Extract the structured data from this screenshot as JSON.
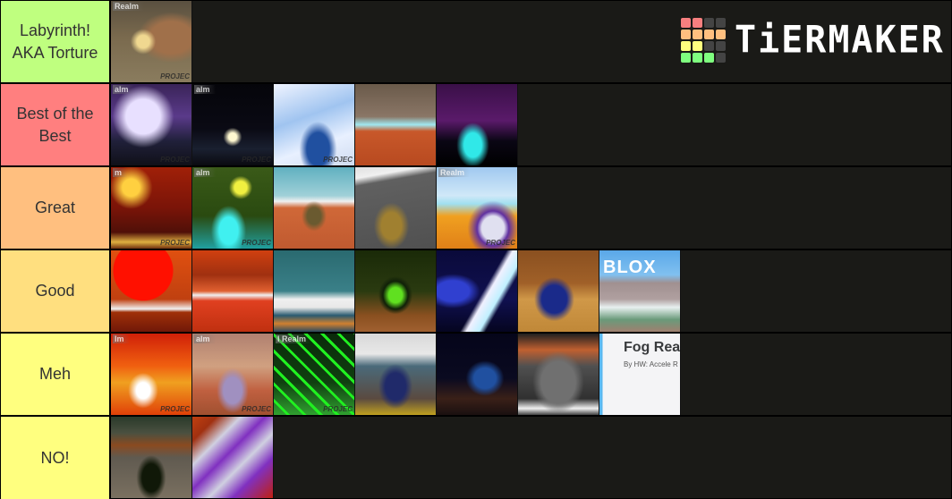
{
  "logo": {
    "text": "TiERMAKER",
    "grid_colors": [
      "#f77f7f",
      "#f77f7f",
      "#444444",
      "#444444",
      "#ffbf7f",
      "#ffbf7f",
      "#ffbf7f",
      "#ffbf7f",
      "#ffff7f",
      "#ffff7f",
      "#444444",
      "#444444",
      "#7fff7f",
      "#7fff7f",
      "#7fff7f",
      "#444444"
    ]
  },
  "tiers": [
    {
      "label": "Labyrinth! AKA Torture",
      "label_lines": [
        "Labyrinth!",
        "AKA Torture"
      ],
      "color": "#bfff7f",
      "items": [
        {
          "name": "labyrinth-monster-car",
          "watermark": "Realm",
          "footer": "PROJEC"
        }
      ]
    },
    {
      "label": "Best of the Best",
      "label_lines": [
        "Best of the",
        "Best"
      ],
      "color": "#ff7f7f",
      "items": [
        {
          "name": "purple-tunnel-blue-car",
          "watermark": "alm",
          "footer": "PROJEC"
        },
        {
          "name": "dark-neon-track",
          "watermark": "alm",
          "footer": "PROJEC"
        },
        {
          "name": "ice-loop-blue-car",
          "watermark": "",
          "footer": "PROJEC"
        },
        {
          "name": "orange-arena-white-car",
          "watermark": "",
          "footer": ""
        },
        {
          "name": "purple-eyes-cyan-car",
          "watermark": "",
          "footer": ""
        }
      ]
    },
    {
      "label": "Great",
      "label_lines": [
        "Great"
      ],
      "color": "#ffbf7f",
      "items": [
        {
          "name": "red-fire-truck",
          "watermark": "m",
          "footer": "PROJEC"
        },
        {
          "name": "green-monster-cyan-car",
          "watermark": "alm",
          "footer": "PROJEC"
        },
        {
          "name": "orange-loop-gold-car",
          "watermark": "",
          "footer": ""
        },
        {
          "name": "gray-road-gold-car",
          "watermark": "",
          "footer": ""
        },
        {
          "name": "sky-track-purple-car",
          "watermark": "Realm",
          "footer": "PROJEC"
        }
      ]
    },
    {
      "label": "Good",
      "label_lines": [
        "Good"
      ],
      "color": "#ffdf7f",
      "items": [
        {
          "name": "red-sun-black-car",
          "watermark": "",
          "footer": ""
        },
        {
          "name": "canyon-glow-track",
          "watermark": "",
          "footer": ""
        },
        {
          "name": "teal-bridge-track",
          "watermark": "",
          "footer": ""
        },
        {
          "name": "dark-green-neon-car",
          "watermark": "",
          "footer": ""
        },
        {
          "name": "space-blue-car-beam",
          "watermark": "",
          "footer": ""
        },
        {
          "name": "sand-blue-car",
          "watermark": "",
          "footer": ""
        },
        {
          "name": "roblox-house",
          "watermark": "BLOX",
          "footer": ""
        }
      ]
    },
    {
      "label": "Meh",
      "label_lines": [
        "Meh"
      ],
      "color": "#ffff7f",
      "items": [
        {
          "name": "lava-loop-car",
          "watermark": "lm",
          "footer": "PROJEC"
        },
        {
          "name": "dusty-loop-silver-car",
          "watermark": "alm",
          "footer": "PROJEC"
        },
        {
          "name": "green-grid-car",
          "watermark": "l Realm",
          "footer": "PROJEC"
        },
        {
          "name": "gray-valley-blue-car",
          "watermark": "",
          "footer": ""
        },
        {
          "name": "night-blue-car",
          "watermark": "",
          "footer": ""
        },
        {
          "name": "stadium-orange-track",
          "watermark": "",
          "footer": ""
        },
        {
          "name": "fog-realm-game-card",
          "title": "Fog Rea",
          "subtitle": "By HW: Accele R"
        }
      ]
    },
    {
      "label": "NO!",
      "label_lines": [
        "NO!"
      ],
      "color": "#ffff7f",
      "items": [
        {
          "name": "room-green-car",
          "watermark": "",
          "footer": ""
        },
        {
          "name": "purple-white-car",
          "watermark": "",
          "footer": ""
        }
      ]
    }
  ]
}
